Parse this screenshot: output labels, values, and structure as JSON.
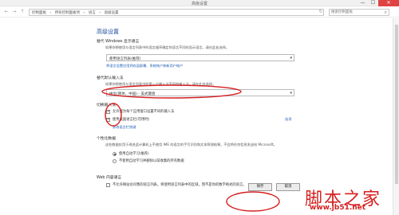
{
  "window": {
    "title": "高级设置",
    "minimize": "—",
    "maximize": "☐",
    "close": "✕"
  },
  "nav": {
    "back": "←",
    "forward": "→",
    "up": "↑",
    "breadcrumbs": [
      "控制面板",
      "›",
      "所有控制面板项",
      "›",
      "语言",
      "›",
      "高级设置"
    ],
    "refresh": "↻",
    "search_placeholder": "搜索控制面板",
    "search_icon": "⌕"
  },
  "page": {
    "title": "高级设置",
    "display_language": {
      "heading": "替代 Windows 显示语言",
      "description": "如果你想使用与语言列表中的语言顺序确定的语言不同的显示语言，请在此处选择。",
      "value": "使用语言列表(推荐)",
      "link": "将语言设置应用到欢迎屏幕、系统帐户和新用户帐户"
    },
    "input_method": {
      "heading": "替代默认输入法",
      "description": "如果你想使用与语言列表中的第一个输入法不同的输入法，请在此处选择。",
      "value": "中文(简体，中国) - 美式键盘"
    },
    "switching": {
      "heading": "切换输入法",
      "check1": "允许我为每个应用窗口设置不同的输入法",
      "check2": "使用桌面语言栏(可用时)",
      "options_link": "选项",
      "hotkey_link": "更改语言栏热键"
    },
    "personalization": {
      "heading": "个性化数据",
      "description": "这些数据仅用于改进此计算机上不使用 IME 的语言的手写识别和文本预测结果。不会将任何信息发送给 Microsoft。",
      "radio1": "使用自动学习(推荐)",
      "radio2": "不使用自动学习并删除以前收集的所有数据"
    },
    "web": {
      "heading": "Web 内容语言",
      "check": "不允许网站访问我的语言列表。将使用语言列表中的区域，而不是你的数字格式的语言。"
    },
    "save": "保存",
    "cancel": "取消"
  },
  "watermark": {
    "cn": "脚本之家",
    "url": "www.jb51.net"
  },
  "colors": {
    "accent": "#1e4e9e",
    "link": "#1b5fb8",
    "annotation": "#d51f1f"
  }
}
